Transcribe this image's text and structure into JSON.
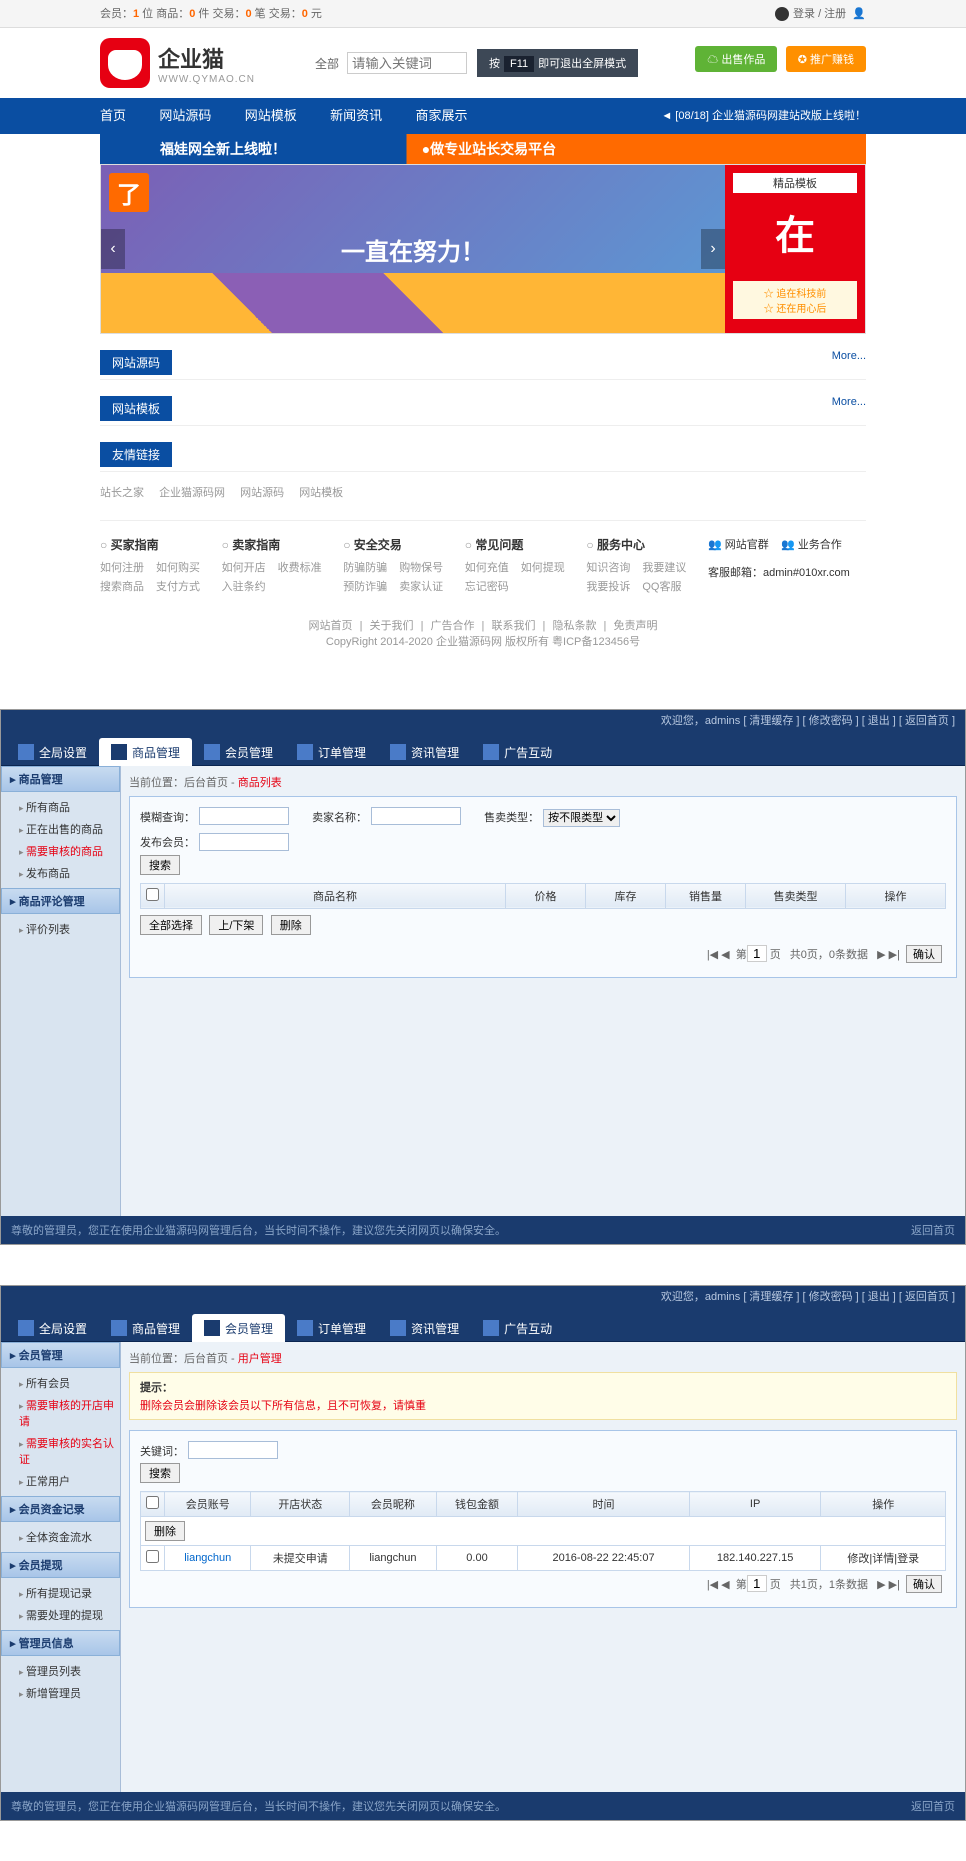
{
  "p1": {
    "topbar": {
      "stats_prefix": "会员：",
      "members": "1",
      "members_suffix": " 位  商品：",
      "products": "0",
      "products_suffix": " 件  交易：",
      "trades": "0",
      "trades_suffix": " 笔  交易：",
      "amount": "0",
      "amount_suffix": " 元",
      "login": "登录 / 注册"
    },
    "logo": {
      "text": "企业猫",
      "sub": "WWW.QYMAO.CN"
    },
    "search": {
      "label": "全部",
      "placeholder": "请输入关键词"
    },
    "f11": {
      "pre": "按",
      "key": "F11",
      "post": "即可退出全屏模式"
    },
    "btns": {
      "green": "☁ 出售作品",
      "orange": "✪ 推广赚钱"
    },
    "nav": [
      "首页",
      "网站源码",
      "网站模板",
      "新闻资讯",
      "商家展示"
    ],
    "announce": "[08/18] 企业猫源码网建站改版上线啦！",
    "banner": {
      "l": "福娃网全新上线啦！",
      "r": "●做专业站长交易平台"
    },
    "slider": {
      "left_badge": "了",
      "left_text": "一直在努力！",
      "right_title": "精品模板",
      "right_big": "在",
      "stars": [
        "☆ 追在科技前",
        "☆ 还在用心后"
      ]
    },
    "cats": [
      {
        "name": "网站源码",
        "more": "More..."
      },
      {
        "name": "网站模板",
        "more": "More..."
      },
      {
        "name": "友情链接",
        "more": ""
      }
    ],
    "tags": [
      "站长之家",
      "企业猫源码网",
      "网站源码",
      "网站模板"
    ],
    "fcols": [
      {
        "h": "买家指南",
        "links": [
          "如何注册",
          "如何购买",
          "搜索商品",
          "支付方式"
        ]
      },
      {
        "h": "卖家指南",
        "links": [
          "如何开店",
          "收费标准",
          "入驻条约"
        ]
      },
      {
        "h": "安全交易",
        "links": [
          "防骗防骗",
          "购物保号",
          "预防诈骗",
          "卖家认证"
        ]
      },
      {
        "h": "常见问题",
        "links": [
          "如何充值",
          "如何提现",
          "忘记密码"
        ]
      },
      {
        "h": "服务中心",
        "links": [
          "知识咨询",
          "我要建议",
          "我要投诉",
          "QQ客服"
        ]
      }
    ],
    "contact": {
      "h1": "网站官群",
      "h2": "业务合作",
      "email": "客服邮箱：admin#010xr.com"
    },
    "footlinks": [
      "网站首页",
      "关于我们",
      "广告合作",
      "联系我们",
      "隐私条款",
      "免责声明"
    ],
    "copyright": "CopyRight 2014-2020 企业猫源码网 版权所有 粤ICP备123456号"
  },
  "p2": {
    "top": {
      "welcome": "欢迎您，admins",
      "links": [
        "清理缓存",
        "修改密码",
        "退出",
        "返回首页"
      ]
    },
    "tabs": [
      "全局设置",
      "商品管理",
      "会员管理",
      "订单管理",
      "资讯管理",
      "广告互动"
    ],
    "active_tab": 1,
    "side": [
      {
        "h": "商品管理",
        "items": [
          {
            "t": "所有商品",
            "red": false
          },
          {
            "t": "正在出售的商品",
            "red": false
          },
          {
            "t": "需要审核的商品",
            "red": true
          },
          {
            "t": "发布商品",
            "red": false
          }
        ]
      },
      {
        "h": "商品评论管理",
        "items": [
          {
            "t": "评价列表",
            "red": false
          }
        ]
      }
    ],
    "crumb": {
      "pre": "当前位置：后台首页 - ",
      "cur": "商品列表"
    },
    "filters": {
      "f1": "模糊查询：",
      "f2": "卖家名称：",
      "f3": "售卖类型：",
      "sel": "按不限类型",
      "f4": "发布会员：",
      "btn": "搜索"
    },
    "cols": [
      "",
      "商品名称",
      "价格",
      "库存",
      "销售量",
      "售卖类型",
      "操作"
    ],
    "tbtns": [
      "全部选择",
      "上/下架",
      "删除"
    ],
    "pager": {
      "nav": "|◀  ◀",
      "page": "1",
      "page_suf": "页",
      "total": "共0页，0条数据",
      "nav2": "▶  ▶|",
      "btn": "确认"
    }
  },
  "p3": {
    "top": {
      "welcome": "欢迎您，admins",
      "links": [
        "清理缓存",
        "修改密码",
        "退出",
        "返回首页"
      ]
    },
    "tabs": [
      "全局设置",
      "商品管理",
      "会员管理",
      "订单管理",
      "资讯管理",
      "广告互动"
    ],
    "active_tab": 2,
    "side": [
      {
        "h": "会员管理",
        "items": [
          {
            "t": "所有会员",
            "red": false
          },
          {
            "t": "需要审核的开店申请",
            "red": true
          },
          {
            "t": "需要审核的实名认证",
            "red": true
          },
          {
            "t": "正常用户",
            "red": false
          }
        ]
      },
      {
        "h": "会员资金记录",
        "items": [
          {
            "t": "全体资金流水",
            "red": false
          }
        ]
      },
      {
        "h": "会员提现",
        "items": [
          {
            "t": "所有提现记录",
            "red": false
          },
          {
            "t": "需要处理的提现",
            "red": false
          }
        ]
      },
      {
        "h": "管理员信息",
        "items": [
          {
            "t": "管理员列表",
            "red": false
          },
          {
            "t": "新增管理员",
            "red": false
          }
        ]
      }
    ],
    "crumb": {
      "pre": "当前位置：后台首页 - ",
      "cur": "用户管理"
    },
    "warn": {
      "h": "提示：",
      "t": "删除会员会删除该会员以下所有信息，且不可恢复，请慎重"
    },
    "filter": {
      "label": "关键词：",
      "btn": "搜索"
    },
    "cols": [
      "",
      "会员账号",
      "开店状态",
      "会员昵称",
      "钱包金额",
      "时间",
      "IP",
      "操作"
    ],
    "tbtn": "删除",
    "row": {
      "user": "liangchun",
      "shop": "未提交申请",
      "nick": "liangchun",
      "money": "0.00",
      "time": "2016-08-22 22:45:07",
      "ip": "182.140.227.15",
      "op": "修改|详情|登录"
    },
    "pager": {
      "nav": "|◀  ◀",
      "page": "1",
      "page_suf": "页",
      "total": "共1页，1条数据",
      "nav2": "▶  ▶|",
      "btn": "确认"
    }
  },
  "adminfoot": {
    "l": "尊敬的管理员，您正在使用企业猫源码网管理后台，当长时间不操作，建议您先关闭网页以确保安全。",
    "r": "返回首页"
  }
}
